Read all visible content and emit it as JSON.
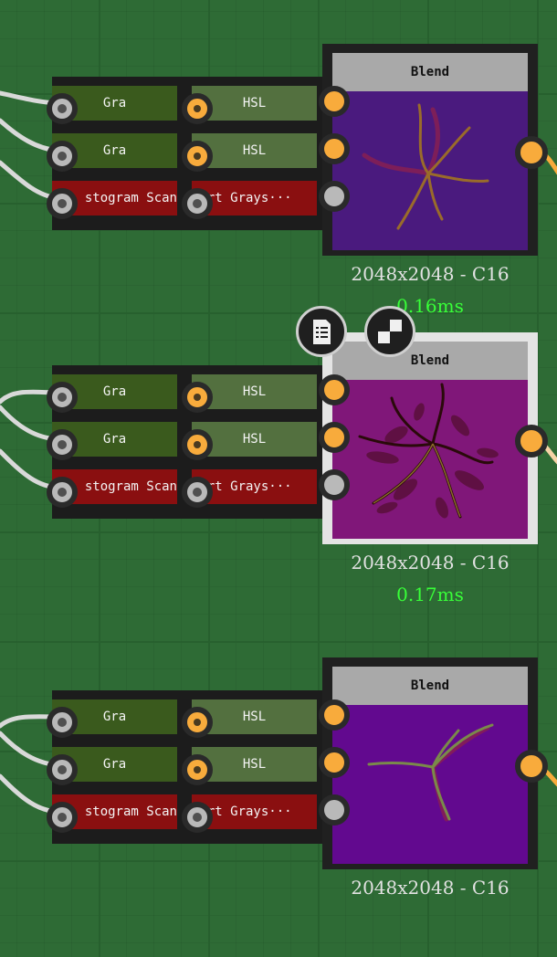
{
  "colors": {
    "canvas": "#2e6b35",
    "wire": "#d9d9d9",
    "wire_out": "#f8ab3c",
    "gray_node": "#3a5a1d",
    "hsl_node": "#53703f",
    "red_node": "#8a0f10",
    "timing": "#38ff38",
    "preview_1": "#4a1a7e",
    "preview_2": "#801779",
    "preview_3": "#62098f"
  },
  "groups": [
    {
      "inputs_a": [
        "Gra",
        "Gra",
        "stogram Scan"
      ],
      "inputs_b": [
        "HSL",
        "HSL",
        "vert Grays···"
      ],
      "blend_title": "Blend",
      "resolution": "2048x2048 - C16",
      "timing": "0.16ms",
      "selected": false
    },
    {
      "inputs_a": [
        "Gra",
        "Gra",
        "stogram Scan"
      ],
      "inputs_b": [
        "HSL",
        "HSL",
        "vert Grays···"
      ],
      "blend_title": "Blend",
      "resolution": "2048x2048 - C16",
      "timing": "0.17ms",
      "selected": true
    },
    {
      "inputs_a": [
        "Gra",
        "Gra",
        "stogram Scan"
      ],
      "inputs_b": [
        "HSL",
        "HSL",
        "vert Grays···"
      ],
      "blend_title": "Blend",
      "resolution": "2048x2048 - C16",
      "timing": "",
      "selected": false
    }
  ],
  "toolbar": {
    "icons": [
      "document-list-icon",
      "checker-icon"
    ]
  }
}
